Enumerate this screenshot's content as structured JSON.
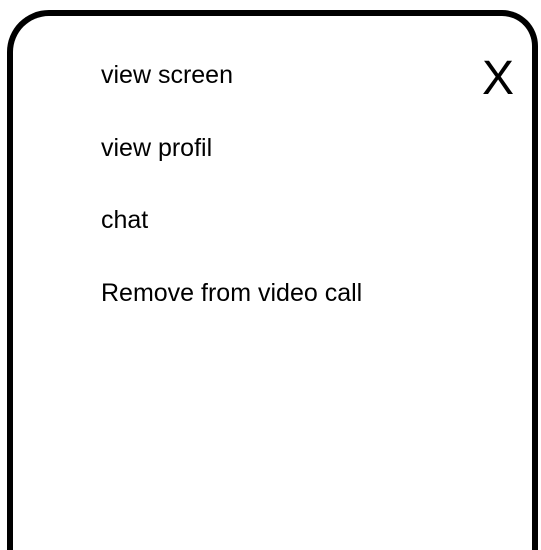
{
  "menu": {
    "items": [
      {
        "label": "view screen"
      },
      {
        "label": "view profil"
      },
      {
        "label": "chat"
      },
      {
        "label": "Remove from video call"
      }
    ],
    "close_label": "X"
  }
}
